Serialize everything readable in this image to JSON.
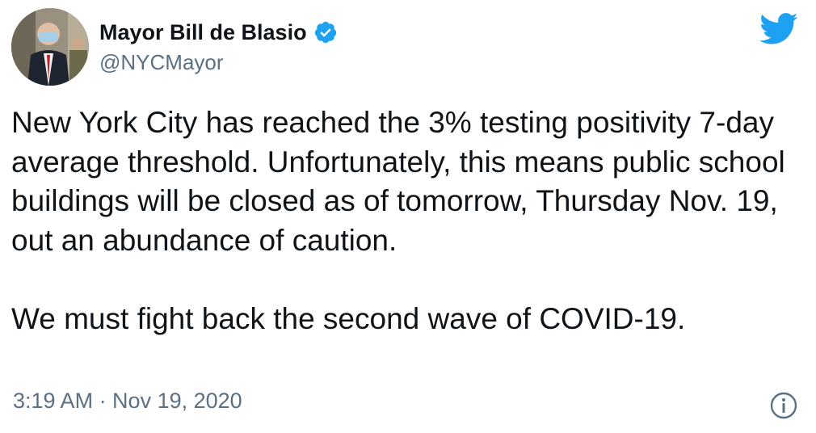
{
  "author": {
    "display_name": "Mayor Bill de Blasio",
    "handle": "@NYCMayor",
    "verified_icon": "verified-badge-icon",
    "avatar": "profile-avatar"
  },
  "tweet": {
    "paragraph_1": "New York City has reached the 3% testing positivity 7-day average threshold. Unfortunately, this means public school buildings will be closed as of tomorrow, Thursday Nov. 19, out an abundance of caution.",
    "paragraph_2": "We must fight back the second wave of COVID-19.",
    "timestamp": "3:19 AM · Nov 19, 2020"
  },
  "icons": {
    "brand": "twitter-bird-icon",
    "info": "info-icon"
  },
  "colors": {
    "twitter_blue": "#1da1f2",
    "text_primary": "#0f1419",
    "text_secondary": "#5b7083"
  }
}
